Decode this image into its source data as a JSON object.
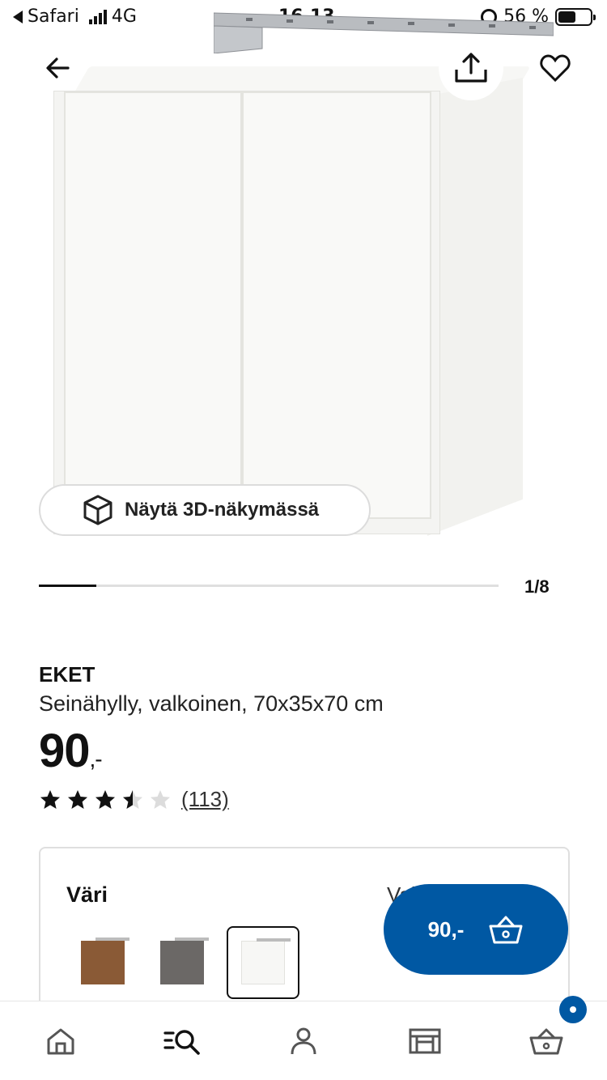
{
  "status_bar": {
    "back_app": "Safari",
    "network": "4G",
    "time": "16.13",
    "battery": "56 %",
    "battery_level": 0.56
  },
  "product_image": {
    "view3d_label": "Näytä 3D-näkymässä",
    "pager": "1/8",
    "pager_progress": 0.125
  },
  "product": {
    "brand": "EKET",
    "description": "Seinähylly, valkoinen, 70x35x70 cm",
    "price": "90",
    "price_suffix": ",-",
    "rating": 3.5,
    "rating_max": 5,
    "review_count": "(113)"
  },
  "color_selector": {
    "label": "Väri",
    "current_value": "Valk",
    "swatches": [
      {
        "name": "walnut",
        "color": "#8a5a36"
      },
      {
        "name": "dark-grey",
        "color": "#6b6866"
      },
      {
        "name": "white",
        "color": "#f7f7f5",
        "selected": true
      }
    ]
  },
  "cart_button": {
    "price": "90,-"
  },
  "colors": {
    "accent": "#0058a3"
  },
  "bottom_nav": [
    "home-icon",
    "search-icon",
    "profile-icon",
    "store-icon",
    "cart-icon"
  ]
}
